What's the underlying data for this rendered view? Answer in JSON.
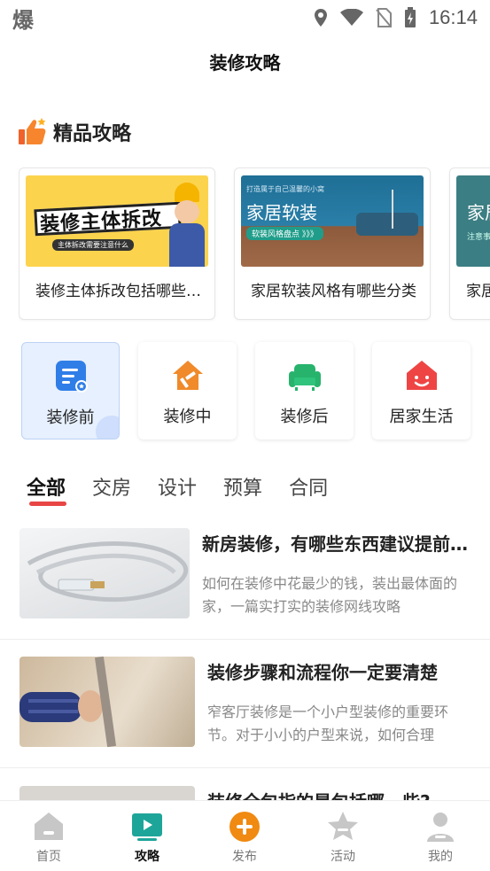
{
  "status_bar": {
    "left_glyph": "爆",
    "time": "16:14",
    "icons": [
      "location-icon",
      "wifi-icon",
      "no-sim-icon",
      "battery-charging-icon"
    ]
  },
  "header": {
    "title": "装修攻略"
  },
  "featured": {
    "section_title": "精品攻略",
    "section_icon": "thumbs-up-icon",
    "cards": [
      {
        "title": "装修主体拆改包括哪些内容",
        "banner_text": "装修主体拆改",
        "banner_sub": "主体拆改需要注意什么"
      },
      {
        "title": "家居软装风格有哪些分类",
        "banner_text": "家居软装",
        "banner_small": "打造属于自己温馨的小窝",
        "banner_sub": "软装风格盘点 》》》"
      },
      {
        "title": "家居",
        "banner_text": "家居",
        "banner_sub": "注意事"
      }
    ]
  },
  "categories": [
    {
      "label": "装修前",
      "icon": "document-icon",
      "color": "#2f7ee8"
    },
    {
      "label": "装修中",
      "icon": "house-hammer-icon",
      "color": "#f08a2a"
    },
    {
      "label": "装修后",
      "icon": "sofa-icon",
      "color": "#27b36c"
    },
    {
      "label": "居家生活",
      "icon": "smiley-house-icon",
      "color": "#ef4444"
    }
  ],
  "tabs": [
    "全部",
    "交房",
    "设计",
    "预算",
    "合同"
  ],
  "articles": [
    {
      "title": "新房装修，有哪些东西建议提前准备",
      "desc": "如何在装修中花最少的钱，装出最体面的家，一篇实打实的装修网线攻略"
    },
    {
      "title": "装修步骤和流程你一定要清楚",
      "desc": "窄客厅装修是一个小户型装修的重要环节。对于小小的户型来说，如何合理"
    },
    {
      "title": "装修全包指的是包括哪一些?",
      "desc": ""
    }
  ],
  "bottom_nav": [
    {
      "label": "首页",
      "icon": "home-icon"
    },
    {
      "label": "攻略",
      "icon": "guide-tv-icon"
    },
    {
      "label": "发布",
      "icon": "plus-circle-icon"
    },
    {
      "label": "活动",
      "icon": "star-badge-icon"
    },
    {
      "label": "我的",
      "icon": "user-icon"
    }
  ],
  "colors": {
    "accent_red": "#e84545",
    "nav_active": "#1ea59a",
    "publish_orange": "#f08a12"
  }
}
